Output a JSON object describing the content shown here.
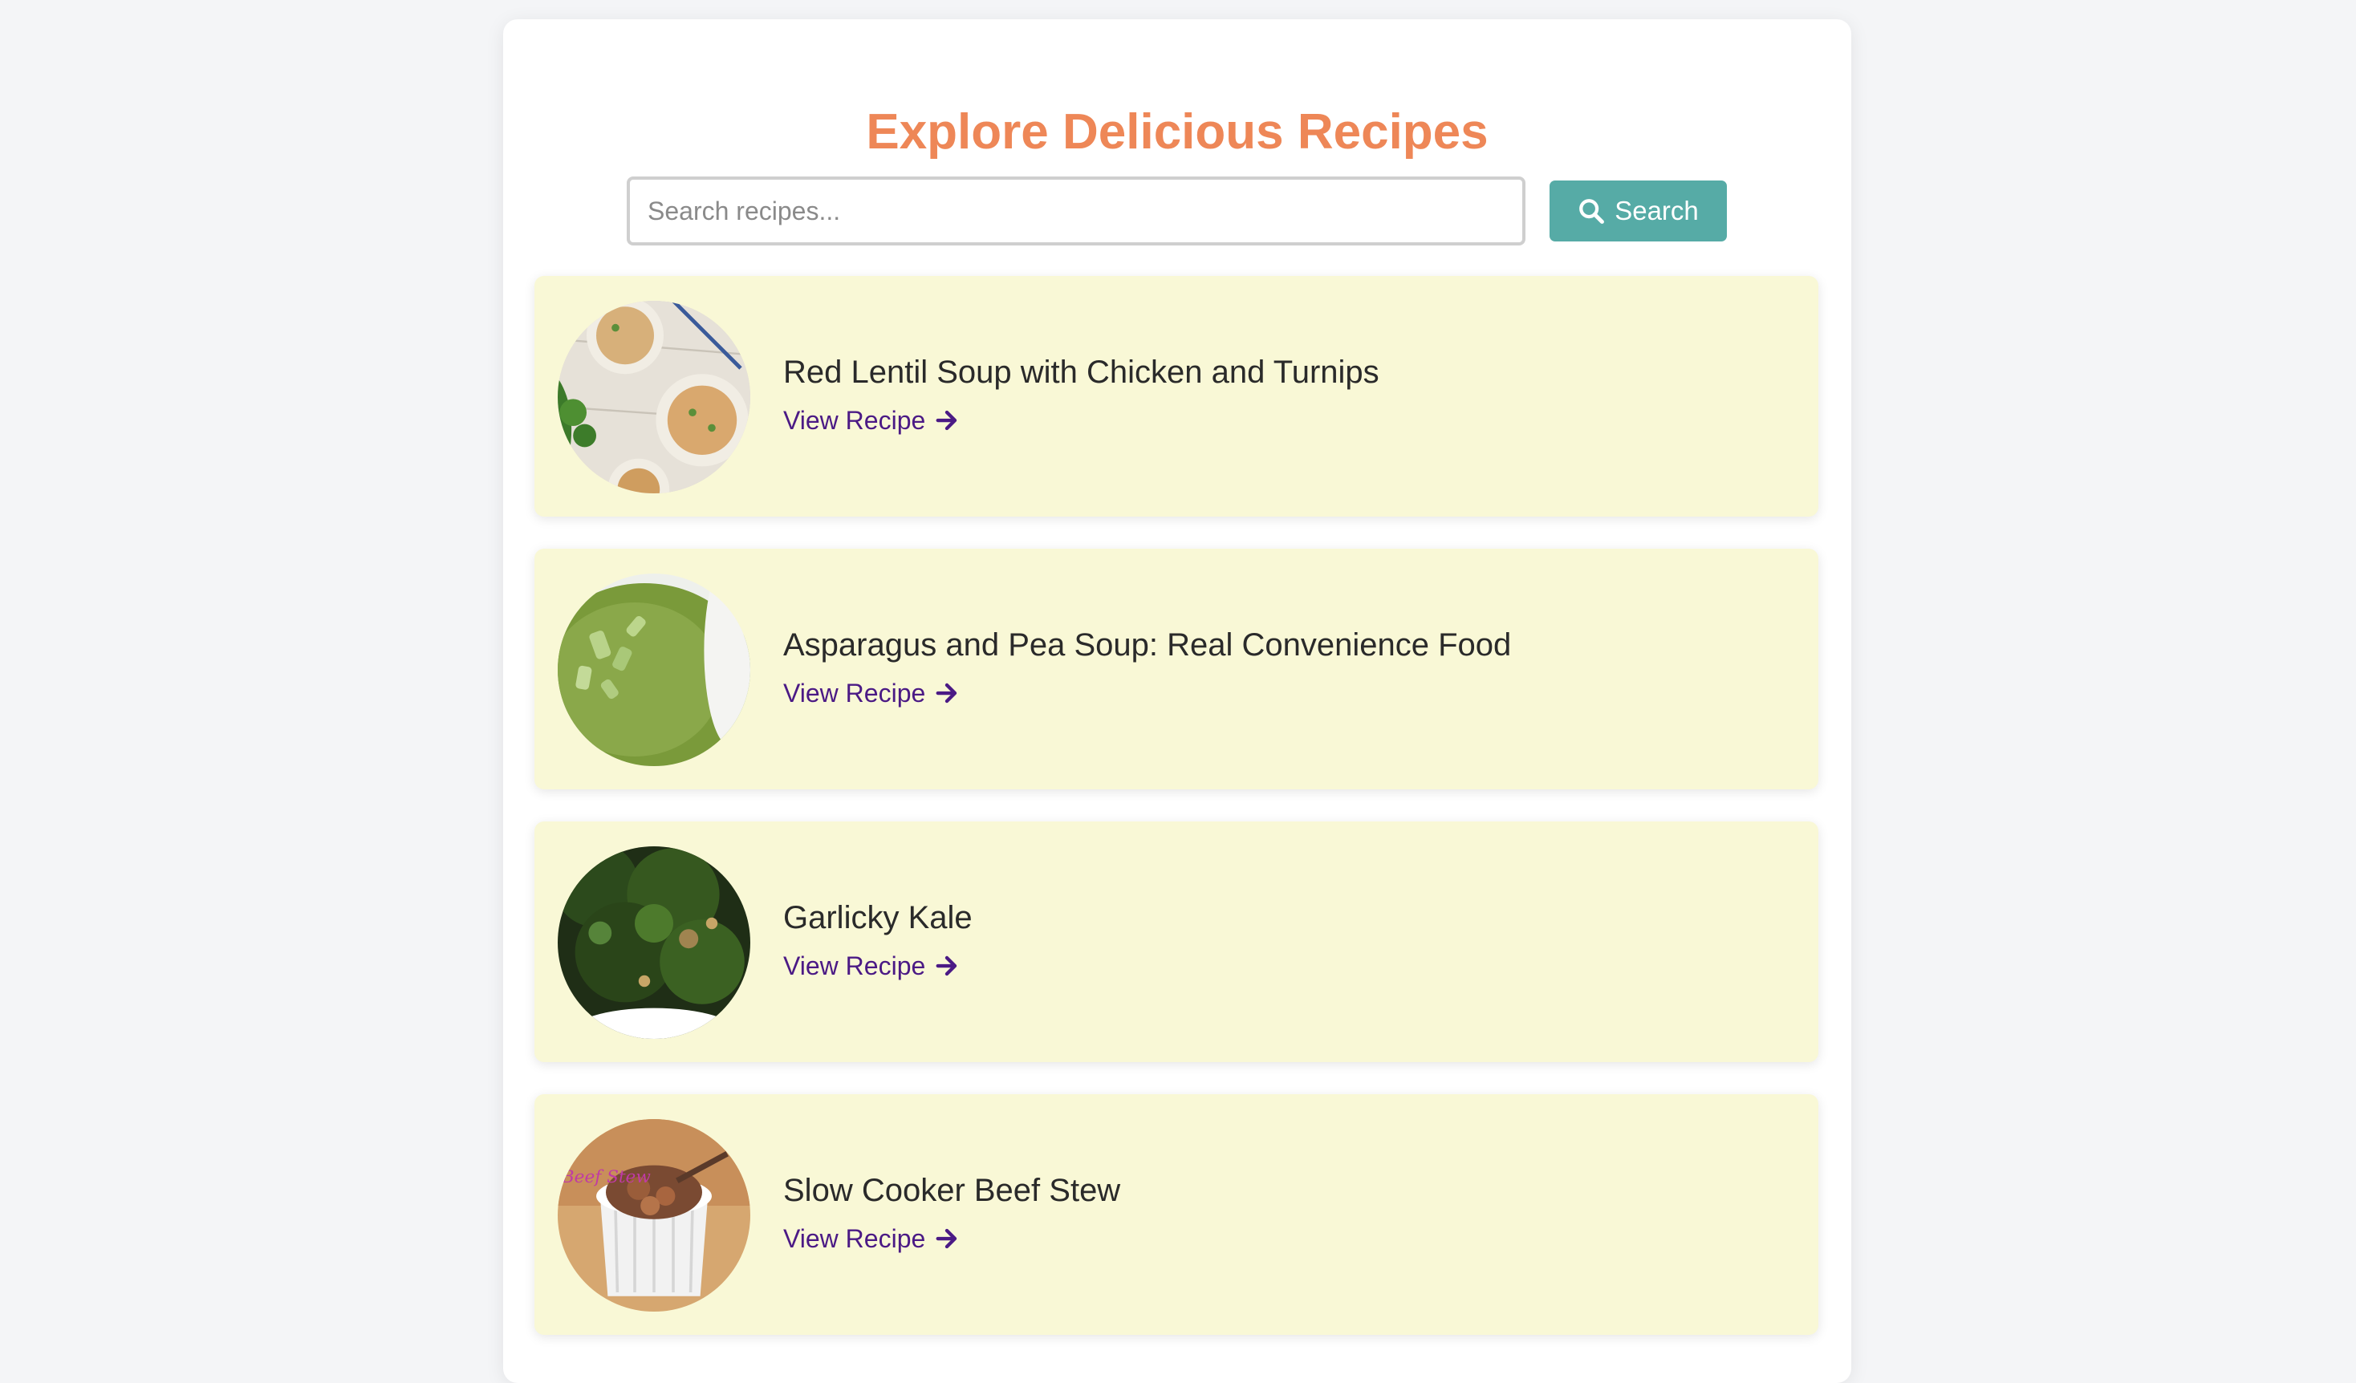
{
  "page": {
    "title": "Explore Delicious Recipes"
  },
  "search": {
    "placeholder": "Search recipes...",
    "value": "",
    "button_label": "Search",
    "button_icon": "search-icon"
  },
  "recipes": [
    {
      "title": "Red Lentil Soup with Chicken and Turnips",
      "link_label": "View Recipe",
      "link_icon": "arrow-right-icon"
    },
    {
      "title": "Asparagus and Pea Soup: Real Convenience Food",
      "link_label": "View Recipe",
      "link_icon": "arrow-right-icon"
    },
    {
      "title": "Garlicky Kale",
      "link_label": "View Recipe",
      "link_icon": "arrow-right-icon"
    },
    {
      "title": "Slow Cooker Beef Stew",
      "link_label": "View Recipe",
      "link_icon": "arrow-right-icon",
      "image_overlay_text": "Beef Stew"
    }
  ],
  "colors": {
    "title": "#ee8757",
    "button": "#56aba6",
    "card_bg": "#f9f8d6",
    "link": "#4b1a85",
    "page_bg": "#f4f5f7"
  }
}
